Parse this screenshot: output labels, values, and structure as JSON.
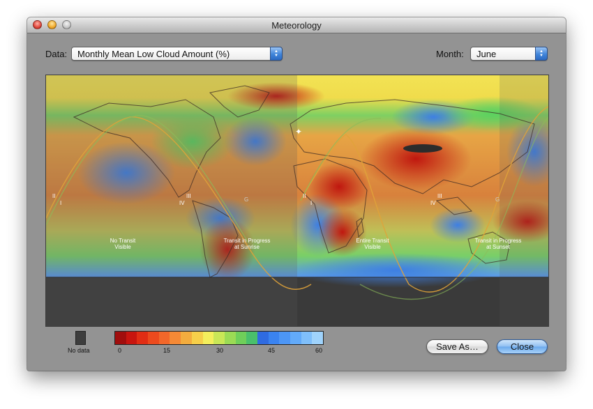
{
  "window": {
    "title": "Meteorology"
  },
  "controls": {
    "data_label": "Data:",
    "data_value": "Monthly Mean Low Cloud Amount (%)",
    "month_label": "Month:",
    "month_value": "June"
  },
  "map": {
    "region_labels": [
      {
        "text": [
          "No Transit",
          "Visible"
        ]
      },
      {
        "text": [
          "Transit in Progress",
          "at Sunrise"
        ]
      },
      {
        "text": [
          "Entire Transit",
          "Visible"
        ]
      },
      {
        "text": [
          "Transit in Progress",
          "at Sunset"
        ]
      }
    ],
    "contact_labels": [
      "II",
      "I",
      "IV",
      "III",
      "G",
      "II",
      "I",
      "IV",
      "III",
      "G"
    ]
  },
  "legend": {
    "no_data_label": "No data",
    "ticks": [
      "0",
      "15",
      "30",
      "45",
      "60"
    ],
    "colors": [
      "#a10e0d",
      "#c8150f",
      "#e12d14",
      "#ec4a1d",
      "#f2672a",
      "#f58935",
      "#f3ac3e",
      "#f6cf4a",
      "#f4ef5c",
      "#c9e757",
      "#9bdb55",
      "#6fcf5a",
      "#49c06c",
      "#2f6be1",
      "#3a83f0",
      "#4c96f6",
      "#62aaf9",
      "#7fbffb",
      "#9fd3fc"
    ]
  },
  "buttons": {
    "save_as": "Save As…",
    "close": "Close"
  }
}
